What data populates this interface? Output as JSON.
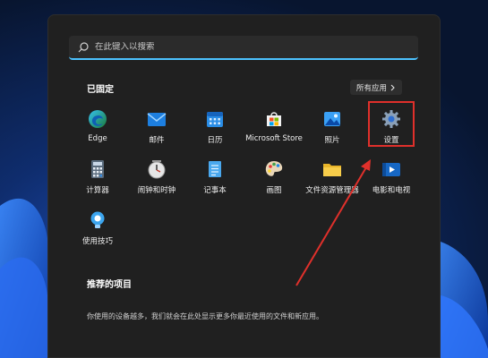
{
  "search": {
    "placeholder": "在此键入以搜索"
  },
  "pinned": {
    "title": "已固定",
    "all_apps_label": "所有应用",
    "apps": [
      {
        "label": "Edge",
        "icon": "edge-icon"
      },
      {
        "label": "邮件",
        "icon": "mail-icon"
      },
      {
        "label": "日历",
        "icon": "calendar-icon"
      },
      {
        "label": "Microsoft Store",
        "icon": "store-icon"
      },
      {
        "label": "照片",
        "icon": "photos-icon"
      },
      {
        "label": "设置",
        "icon": "settings-gear-icon"
      },
      {
        "label": "计算器",
        "icon": "calculator-icon"
      },
      {
        "label": "闹钟和时钟",
        "icon": "clock-icon"
      },
      {
        "label": "记事本",
        "icon": "notepad-icon"
      },
      {
        "label": "画图",
        "icon": "paint-palette-icon"
      },
      {
        "label": "文件资源管理器",
        "icon": "folder-icon"
      },
      {
        "label": "电影和电视",
        "icon": "movies-tv-icon"
      },
      {
        "label": "使用技巧",
        "icon": "tips-lightbulb-icon"
      }
    ]
  },
  "recommended": {
    "title": "推荐的项目",
    "description": "你使用的设备越多，我们就会在此处显示更多你最近使用的文件和新应用。"
  },
  "colors": {
    "menu_bg": "#202020",
    "accent": "#4cc2ff",
    "highlight_box": "#e0302b",
    "annotation_arrow": "#e0302b"
  }
}
